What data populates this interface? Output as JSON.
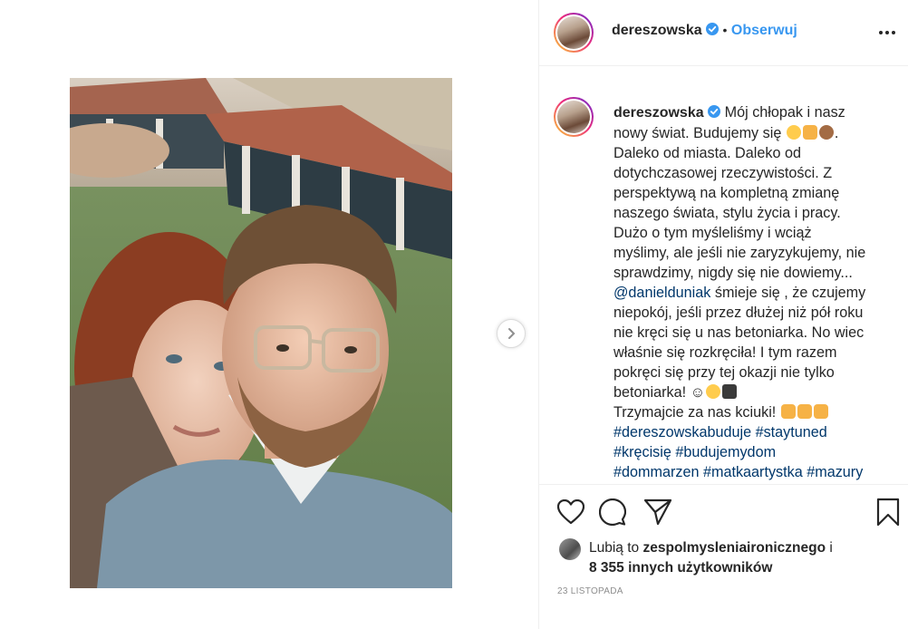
{
  "post": {
    "username": "dereszowska",
    "separator": "•",
    "follow_label": "Obserwuj",
    "caption_lines": [
      "Mój chłopak i nasz",
      "nowy świat. Budujemy się",
      "Daleko od miasta. Daleko od",
      "dotychczasowej rzeczywistości. Z",
      "perspektywą na kompletną zmianę",
      "naszego świata, stylu życia i pracy.",
      "Dużo o tym myśleliśmy i wciąż",
      "myślimy, ale jeśli nie zaryzykujemy, nie",
      "sprawdzimy, nigdy się nie dowiemy...",
      "śmieje się , że czujemy",
      "niepokój, jeśli przez dłużej niż pół roku",
      "nie kręci się u nas betoniarka. No wiec",
      "właśnie się rozkręciła! I tym razem",
      "pokręci się przy tej okazji nie tylko",
      "betoniarka! ☺",
      "Trzymajcie za nas kciuki!"
    ],
    "mention": "@danielduniak",
    "hashtag_lines": [
      "#dereszowskabuduje #staytuned",
      "#kręcisię #budujemydom",
      "#dommarzen #matkaartystka #mazury"
    ],
    "likes_prefix": "Lubią to",
    "likes_user": "zespolmysleniaironicznego",
    "likes_and": "i",
    "likes_count_text": "8 355 innych użytkowników",
    "timestamp": "23 listopada"
  },
  "icons": {
    "like": "heart-icon",
    "comment": "comment-icon",
    "share": "paper-plane-icon",
    "save": "bookmark-icon",
    "more": "ellipsis-icon",
    "next": "chevron-right-icon",
    "verified": "verified-badge-icon"
  },
  "colors": {
    "accent": "#3897f0",
    "link": "#00376b",
    "text": "#262626",
    "muted": "#8e8e8e",
    "verified": "#3897f0"
  }
}
